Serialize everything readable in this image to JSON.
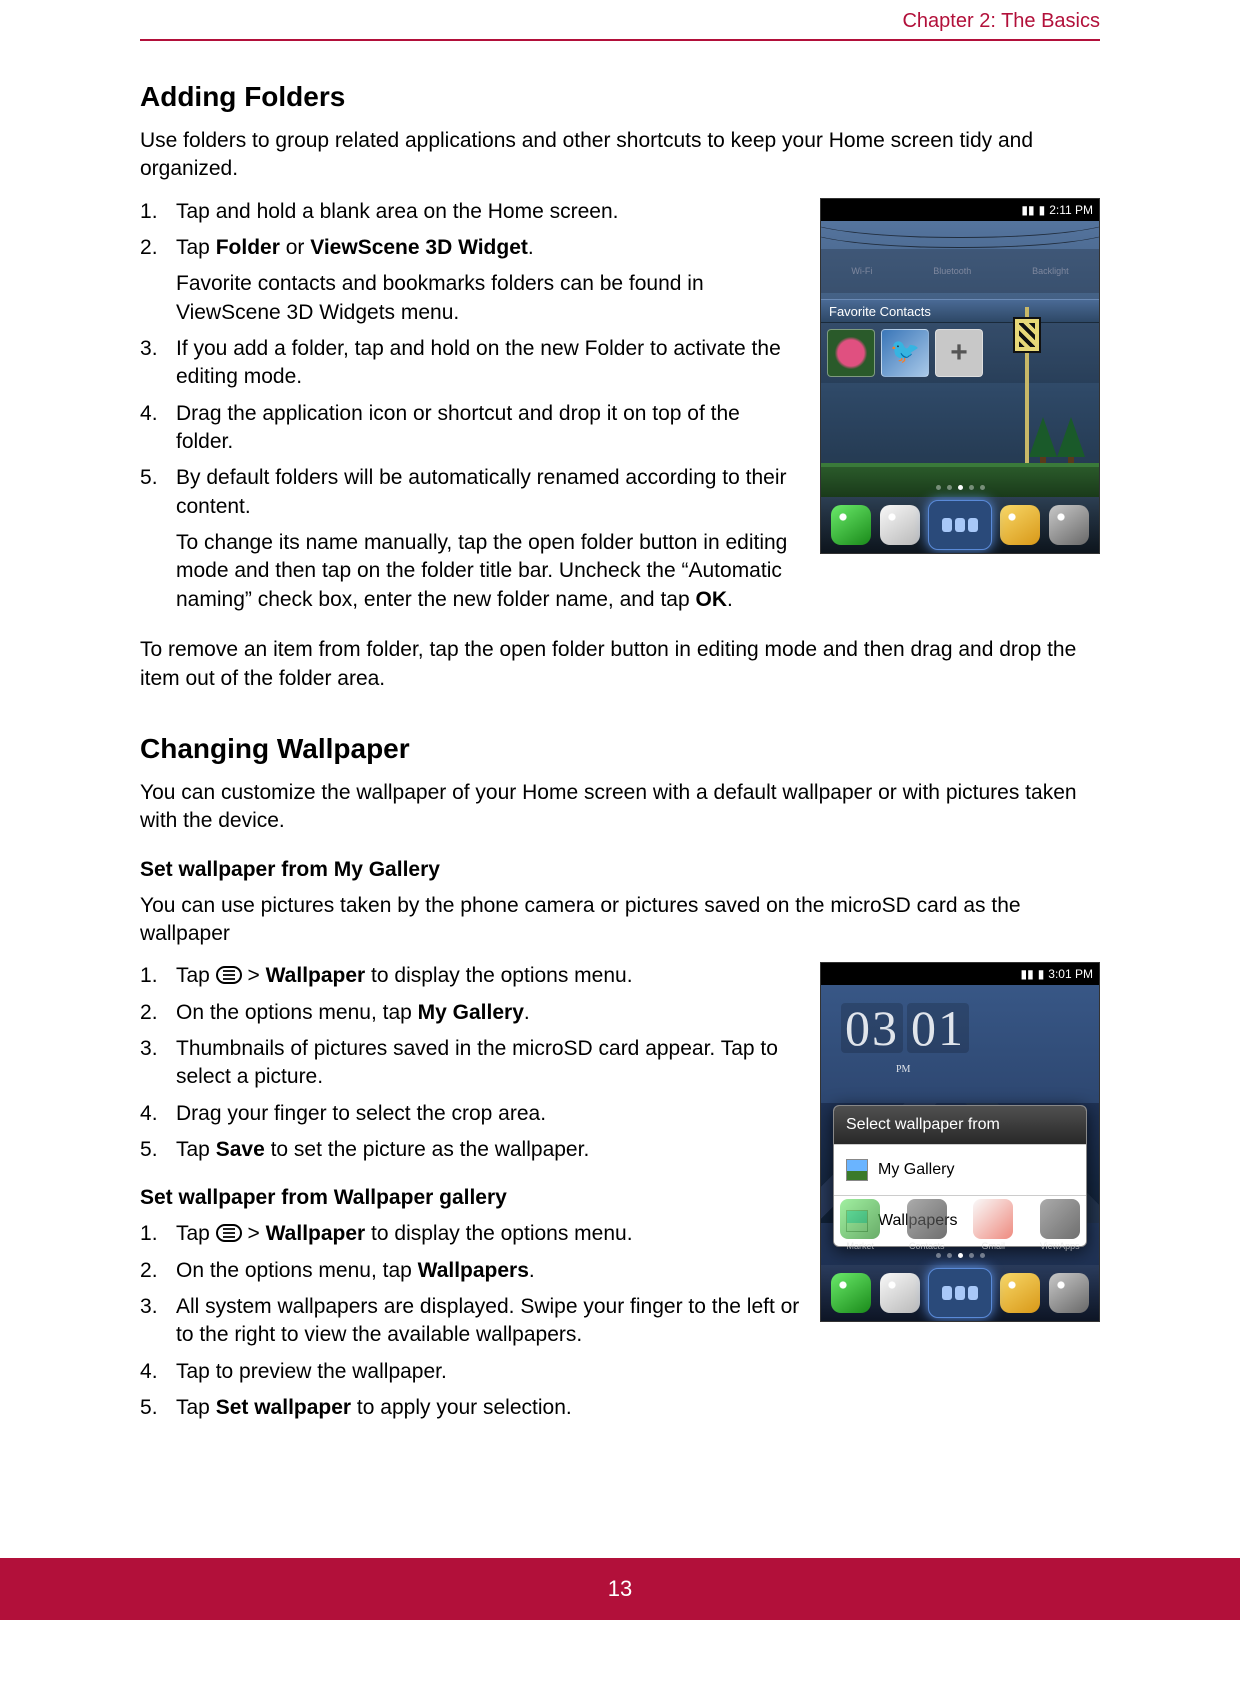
{
  "chapter": "Chapter 2: The Basics",
  "page_number": "13",
  "sections": {
    "adding_folders": {
      "title": "Adding Folders",
      "intro": "Use folders to group related applications and other shortcuts to keep your Home screen tidy and organized.",
      "steps": {
        "s1": "Tap and hold a blank area on the Home screen.",
        "s2_pre": "Tap ",
        "s2_b1": "Folder",
        "s2_mid": " or ",
        "s2_b2": "ViewScene 3D Widget",
        "s2_post": ".",
        "s2_note": "Favorite contacts and bookmarks folders can be found in ViewScene 3D Widgets menu.",
        "s3": "If you add a folder, tap and hold on the new Folder to activate the editing mode.",
        "s4": "Drag the application icon or shortcut and drop it on top of the folder.",
        "s5": "By default folders will be automatically renamed according to their content.",
        "s5_note_pre": "To change its name manually, tap the open folder button in editing mode and then tap on the folder title bar. Uncheck the “Automatic naming” check box, enter the new folder name, and tap ",
        "s5_note_b": "OK",
        "s5_note_post": "."
      },
      "after": "To remove an item from folder, tap the open folder button in editing mode and then drag and drop the item out of the folder area."
    },
    "changing_wallpaper": {
      "title": "Changing Wallpaper",
      "intro": "You can customize the wallpaper of your Home screen with a default wallpaper or with pictures taken with the device.",
      "sub1": {
        "title": "Set wallpaper from My Gallery",
        "intro": "You can use pictures taken by the phone camera or pictures saved on the microSD card as the wallpaper",
        "steps": {
          "s1_pre": "Tap ",
          "s1_mid": " > ",
          "s1_b": "Wallpaper",
          "s1_post": " to display the options menu.",
          "s2_pre": "On the options menu, tap ",
          "s2_b": "My Gallery",
          "s2_post": ".",
          "s3": "Thumbnails of pictures saved in the microSD card appear. Tap to select a picture.",
          "s4": "Drag your finger to select the crop area.",
          "s5_pre": "Tap ",
          "s5_b": "Save",
          "s5_post": " to set the picture as the wallpaper."
        }
      },
      "sub2": {
        "title": "Set wallpaper from Wallpaper gallery",
        "steps": {
          "s1_pre": "Tap ",
          "s1_mid": " > ",
          "s1_b": "Wallpaper",
          "s1_post": " to display the options menu.",
          "s2_pre": "On the options menu, tap ",
          "s2_b": "Wallpapers",
          "s2_post": ".",
          "s3": "All system wallpapers are displayed. Swipe your finger to the left or to the right to view the available wallpapers.",
          "s4": "Tap to preview the wallpaper.",
          "s5_pre": "Tap ",
          "s5_b": "Set wallpaper",
          "s5_post": " to apply your selection."
        }
      }
    }
  },
  "screenshot1": {
    "time": "2:11 PM",
    "fav_label": "Favorite Contacts",
    "toggles": {
      "t1": "Wi-Fi",
      "t2": "Bluetooth",
      "t3": "Backlight"
    }
  },
  "screenshot2": {
    "time": "3:01 PM",
    "clock_h": "03",
    "clock_m": "01",
    "ampm": "PM",
    "overlay_title": "Select wallpaper from",
    "opt1": "My Gallery",
    "opt2": "Wallpapers",
    "apps": {
      "a1": "Market",
      "a2": "Contacts",
      "a3": "Gmail",
      "a4": "ViewApps"
    }
  }
}
